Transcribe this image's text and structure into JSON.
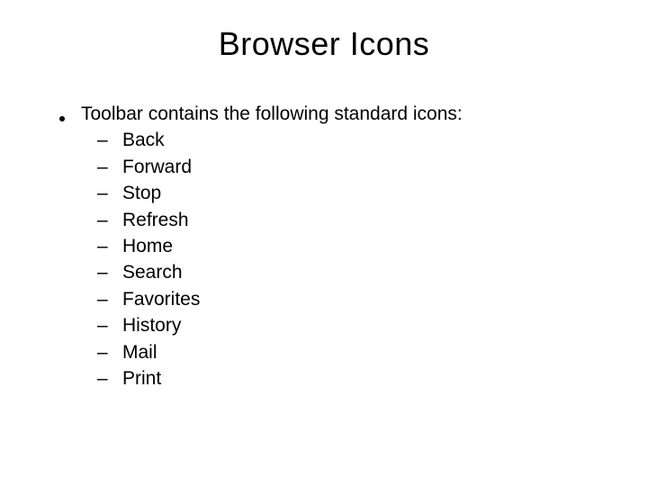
{
  "title": "Browser Icons",
  "main_bullet": "Toolbar contains the following standard icons:",
  "sub_marker": "–",
  "items": {
    "0": "Back",
    "1": "Forward",
    "2": "Stop",
    "3": "Refresh",
    "4": "Home",
    "5": "Search",
    "6": "Favorites",
    "7": "History",
    "8": "Mail",
    "9": "Print"
  }
}
